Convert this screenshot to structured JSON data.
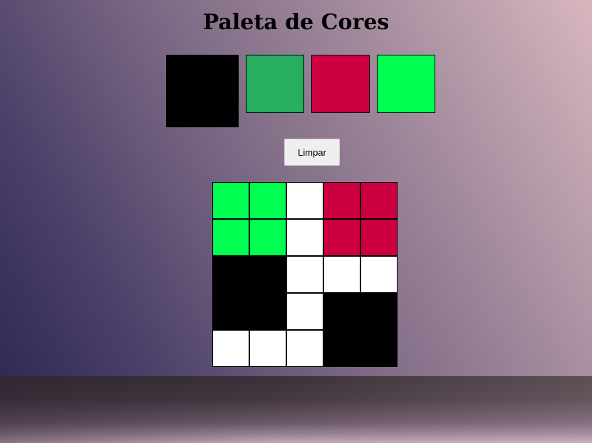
{
  "page": {
    "title": "Paleta de Cores"
  },
  "palette": {
    "colors": [
      "#000000",
      "#27ae60",
      "#cc0040",
      "#00ff50"
    ],
    "selected_index": 0
  },
  "controls": {
    "clear_label": "Limpar"
  },
  "board": {
    "rows": [
      [
        "#00ff50",
        "#00ff50",
        "#ffffff",
        "#cc0040",
        "#cc0040"
      ],
      [
        "#00ff50",
        "#00ff50",
        "#ffffff",
        "#cc0040",
        "#cc0040"
      ],
      [
        "#000000",
        "#000000",
        "#ffffff",
        "#ffffff",
        "#ffffff"
      ],
      [
        "#000000",
        "#000000",
        "#ffffff",
        "#000000",
        "#000000"
      ],
      [
        "#ffffff",
        "#ffffff",
        "#ffffff",
        "#000000",
        "#000000"
      ]
    ]
  }
}
